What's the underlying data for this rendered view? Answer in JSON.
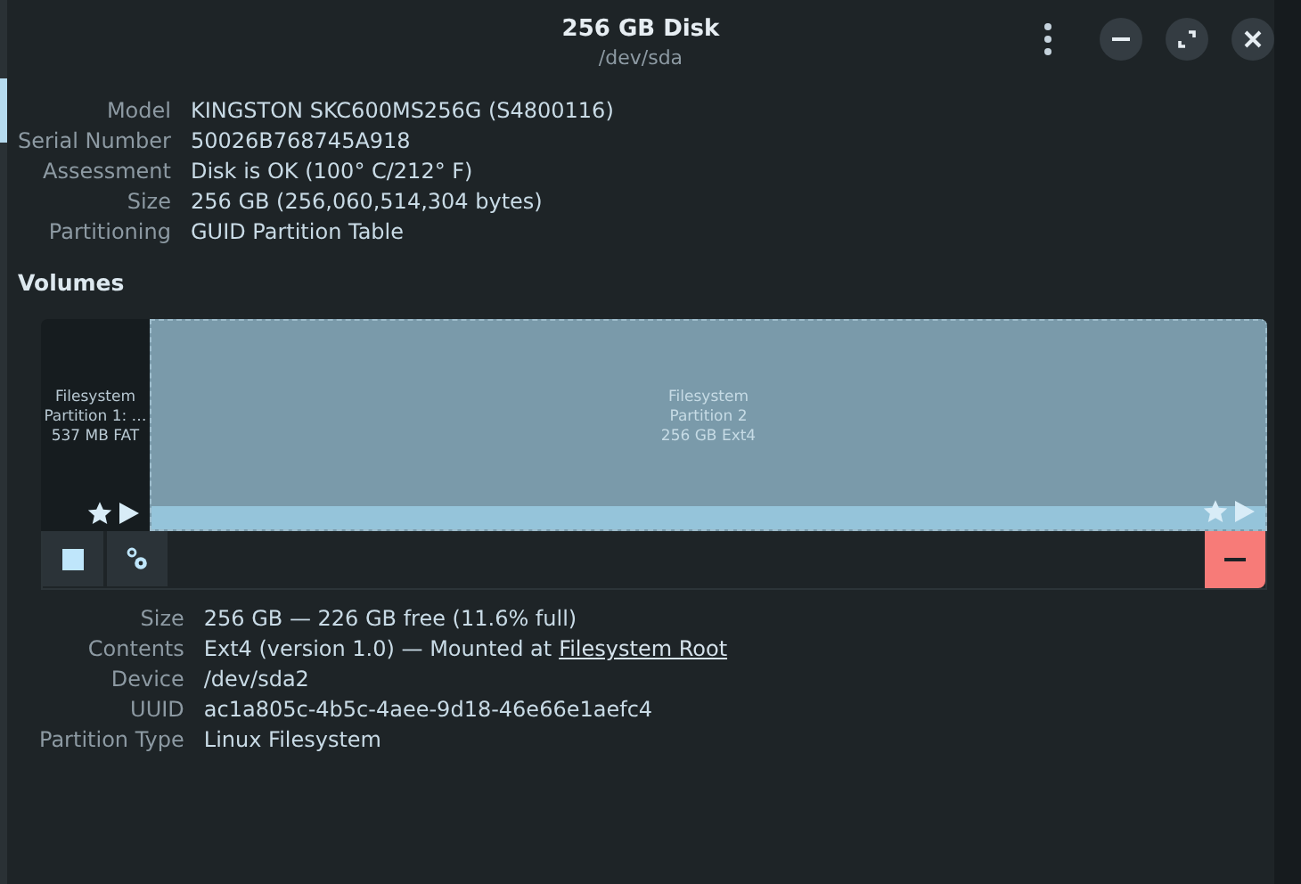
{
  "window": {
    "title": "256 GB Disk",
    "subtitle": "/dev/sda"
  },
  "disk_info": [
    {
      "label": "Model",
      "value": "KINGSTON SKC600MS256G (S4800116)"
    },
    {
      "label": "Serial Number",
      "value": "50026B768745A918"
    },
    {
      "label": "Assessment",
      "value": "Disk is OK (100° C/212° F)"
    },
    {
      "label": "Size",
      "value": "256 GB (256,060,514,304 bytes)"
    },
    {
      "label": "Partitioning",
      "value": "GUID Partition Table"
    }
  ],
  "volumes": {
    "heading": "Volumes",
    "partitions": [
      {
        "lines": [
          "Filesystem",
          "Partition 1: …",
          "537 MB FAT"
        ],
        "selected": false
      },
      {
        "lines": [
          "Filesystem",
          "Partition 2",
          "256 GB Ext4"
        ],
        "selected": true
      }
    ]
  },
  "details": [
    {
      "label": "Size",
      "value": "256 GB — 226 GB free (11.6% full)"
    },
    {
      "label": "Contents",
      "value": "Ext4 (version 1.0) — Mounted at",
      "link": "Filesystem Root"
    },
    {
      "label": "Device",
      "value": "/dev/sda2"
    },
    {
      "label": "UUID",
      "value": "ac1a805c-4b5c-4aee-9d18-46e66e1aefc4"
    },
    {
      "label": "Partition Type",
      "value": "Linux Filesystem"
    }
  ]
}
